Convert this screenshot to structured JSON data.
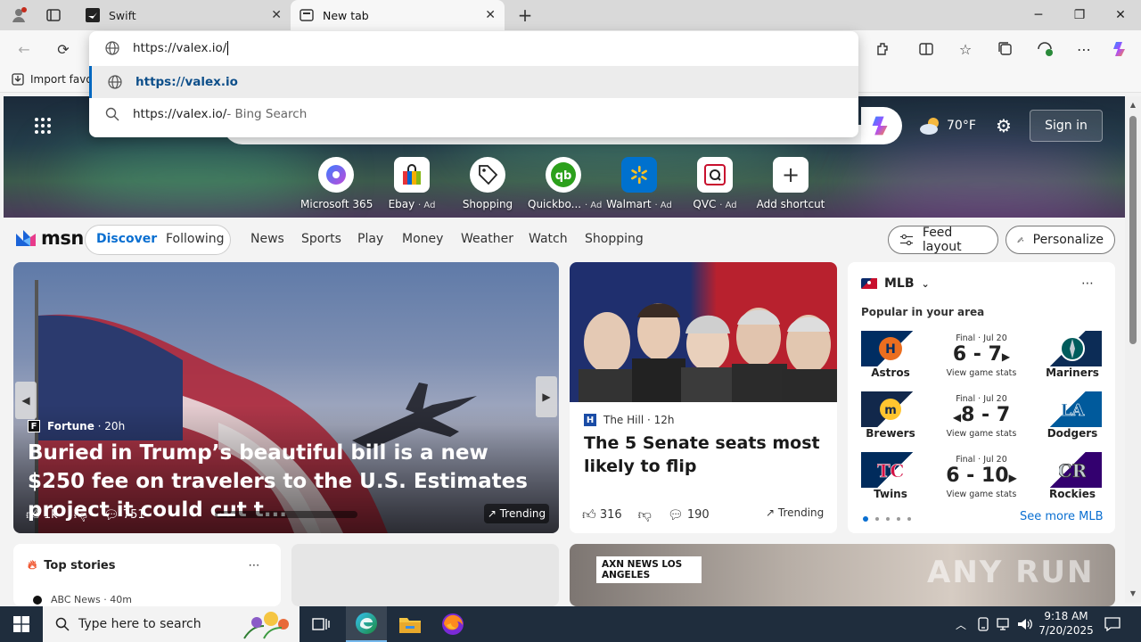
{
  "browser": {
    "tabs": [
      {
        "label": "Swift"
      },
      {
        "label": "New tab"
      }
    ],
    "address_value": "https://valex.io/",
    "suggestions": [
      {
        "text": "https://valex.io",
        "suffix": ""
      },
      {
        "text": "https://valex.io/",
        "suffix": " - Bing Search"
      }
    ],
    "favbar_import": "Import favor"
  },
  "newtab": {
    "weather_temp": "70°F",
    "sign_in": "Sign in",
    "shortcuts": [
      {
        "label": "Microsoft 365",
        "ad": ""
      },
      {
        "label": "Ebay",
        "ad": "· Ad"
      },
      {
        "label": "Shopping",
        "ad": ""
      },
      {
        "label": "Quickbo...",
        "ad": "· Ad"
      },
      {
        "label": "Walmart",
        "ad": "· Ad"
      },
      {
        "label": "QVC",
        "ad": "· Ad"
      },
      {
        "label": "Add shortcut",
        "ad": ""
      }
    ]
  },
  "msn": {
    "logo": "msn",
    "tabs": [
      "Discover",
      "Following"
    ],
    "nav": [
      "News",
      "Sports",
      "Play",
      "Money",
      "Weather",
      "Watch",
      "Shopping"
    ],
    "feed_layout": "Feed layout",
    "personalize": "Personalize"
  },
  "hero_story": {
    "source": "Fortune",
    "age": "· 20h",
    "headline": "Buried in Trump’s beautiful bill is a new $250 fee on travelers to the U.S. Estimates project it could cut t...",
    "likes": "1k",
    "comments": "751",
    "trending": "Trending"
  },
  "second_story": {
    "source": "The Hill",
    "age": "· 12h",
    "headline": "The 5 Senate seats most likely to flip",
    "likes": "316",
    "comments": "190",
    "trending": "Trending"
  },
  "mlb": {
    "title": "MLB",
    "subtitle": "Popular in your area",
    "see_more": "See more MLB",
    "games": [
      {
        "status": "Final · Jul 20",
        "score": "6 - 7",
        "home": "Astros",
        "away": "Mariners",
        "link": "View game stats"
      },
      {
        "status": "Final · Jul 20",
        "score": "8 - 7",
        "home": "Brewers",
        "away": "Dodgers",
        "link": "View game stats"
      },
      {
        "status": "Final · Jul 20",
        "score": "6 - 10",
        "home": "Twins",
        "away": "Rockies",
        "link": "View game stats"
      }
    ]
  },
  "top_stories": {
    "title": "Top stories",
    "first_source": "ABC News · 40m"
  },
  "bottom_image_text": "AXN NEWS LOS ANGELES",
  "watermark": "ANY RUN",
  "taskbar": {
    "search_placeholder": "Type here to search",
    "time": "9:18 AM",
    "date": "7/20/2025"
  }
}
